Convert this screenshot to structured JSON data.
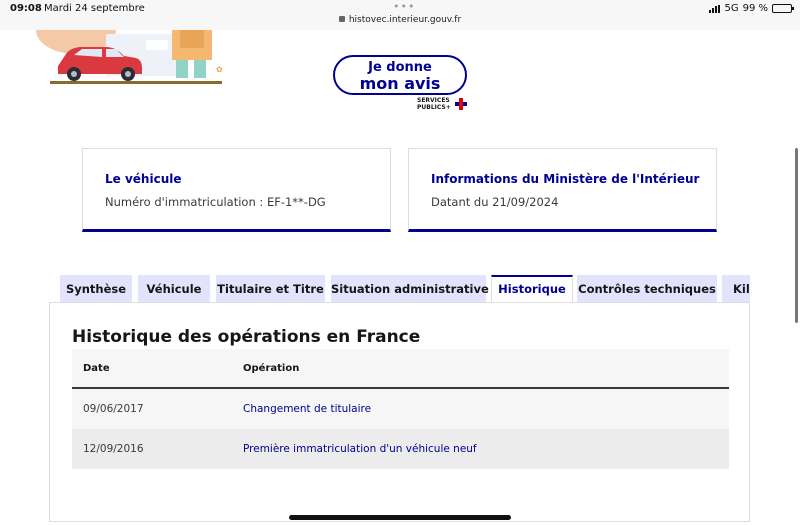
{
  "status_bar": {
    "time": "09:08",
    "date": "Mardi 24 septembre",
    "url": "histovec.interieur.gouv.fr",
    "network": "5G",
    "battery": "99 %"
  },
  "feedback": {
    "line1": "Je donne",
    "line2": "mon avis",
    "logo_line1": "SERVICES",
    "logo_line2": "PUBLICS+"
  },
  "cards": [
    {
      "title": "Le véhicule",
      "text": "Numéro d'immatriculation : EF-1**-DG"
    },
    {
      "title": "Informations du Ministère de l'Intérieur",
      "text": "Datant du 21/09/2024"
    }
  ],
  "tabs": [
    {
      "label": "Synthèse",
      "active": false
    },
    {
      "label": "Véhicule",
      "active": false
    },
    {
      "label": "Titulaire et Titre",
      "active": false
    },
    {
      "label": "Situation administrative",
      "active": false
    },
    {
      "label": "Historique",
      "active": true
    },
    {
      "label": "Contrôles techniques",
      "active": false
    },
    {
      "label": "Kilométrage",
      "active": false
    }
  ],
  "history": {
    "title": "Historique des opérations en France",
    "columns": [
      "Date",
      "Opération"
    ],
    "rows": [
      {
        "date": "09/06/2017",
        "operation": "Changement de titulaire"
      },
      {
        "date": "12/09/2016",
        "operation": "Première immatriculation d'un véhicule neuf"
      }
    ]
  },
  "colors": {
    "primary": "#000091",
    "tab_bg": "#e3e3fd",
    "accent_red": "#e1000f"
  }
}
